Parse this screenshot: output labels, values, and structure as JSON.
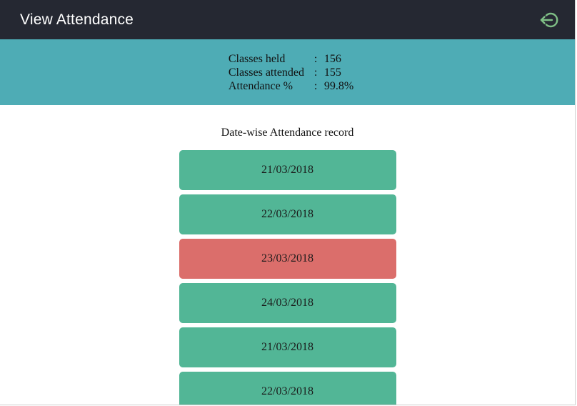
{
  "header": {
    "title": "View Attendance",
    "logout_icon": "logout-icon",
    "logout_icon_color": "#7fbf86"
  },
  "summary": {
    "rows": [
      {
        "label": "Classes held",
        "sep": ":",
        "value": "156"
      },
      {
        "label": "Classes attended",
        "sep": ":",
        "value": "155"
      },
      {
        "label": "Attendance %",
        "sep": ":",
        "value": "99.8%"
      }
    ],
    "background": "#4eacb5"
  },
  "records_section": {
    "heading": "Date-wise Attendance record",
    "present_color": "#52b696",
    "absent_color": "#db6e6b",
    "items": [
      {
        "date": "21/03/2018",
        "status": "present"
      },
      {
        "date": "22/03/2018",
        "status": "present"
      },
      {
        "date": "23/03/2018",
        "status": "absent"
      },
      {
        "date": "24/03/2018",
        "status": "present"
      },
      {
        "date": "21/03/2018",
        "status": "present"
      },
      {
        "date": "22/03/2018",
        "status": "present"
      }
    ]
  }
}
